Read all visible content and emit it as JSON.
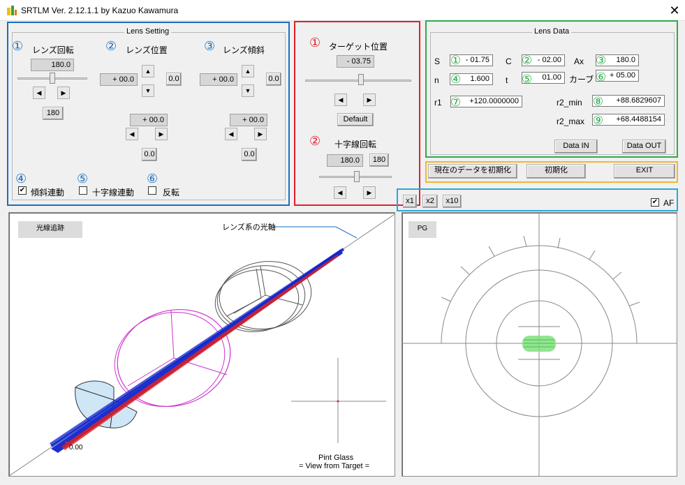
{
  "window": {
    "title": "SRTLM Ver. 2.12.1.1 by Kazuo Kawamura",
    "close_glyph": "✕"
  },
  "lens_setting": {
    "title": "Lens Setting",
    "rotation": {
      "num": "①",
      "label": "レンズ回転",
      "value": "180.0",
      "btn180": "180"
    },
    "position": {
      "num": "②",
      "label": "レンズ位置",
      "value1": "+ 00.0",
      "zero1": "0.0",
      "value2": "+ 00.0",
      "zero2": "0.0"
    },
    "tilt": {
      "num": "③",
      "label": "レンズ傾斜",
      "value1": "+ 00.0",
      "zero1": "0.0",
      "value2": "+ 00.0",
      "zero2": "0.0"
    },
    "tilt_link": {
      "num": "④",
      "label": "傾斜連動",
      "checked": "✔"
    },
    "cross_link": {
      "num": "⑤",
      "label": "十字線連動"
    },
    "reverse": {
      "num": "⑥",
      "label": "反転"
    }
  },
  "target": {
    "pos": {
      "num": "①",
      "label": "ターゲット位置",
      "value": "- 03.75",
      "default_btn": "Default"
    },
    "cross": {
      "num": "②",
      "label": "十字線回転",
      "value": "180.0",
      "btn180": "180"
    }
  },
  "lens_data": {
    "title": "Lens Data",
    "S": {
      "label": "S",
      "num": "①",
      "value": "- 01.75"
    },
    "C": {
      "label": "C",
      "num": "②",
      "value": "- 02.00"
    },
    "Ax": {
      "label": "Ax",
      "num": "③",
      "value": "180.0"
    },
    "n": {
      "label": "n",
      "num": "④",
      "value": "1.600"
    },
    "t": {
      "label": "t",
      "num": "⑤",
      "value": "01.00"
    },
    "curve": {
      "label": "カーブ",
      "num": "⑥",
      "value": "+ 05.00"
    },
    "r1": {
      "label": "r1",
      "num": "⑦",
      "value": "+120.0000000"
    },
    "r2min": {
      "label": "r2_min",
      "num": "⑧",
      "value": "+88.6829607"
    },
    "r2max": {
      "label": "r2_max",
      "num": "⑨",
      "value": "+68.4488154"
    },
    "data_in": "Data IN",
    "data_out": "Data OUT"
  },
  "actions": {
    "reset_current": "現在のデータを初期化",
    "reset": "初期化",
    "exit": "EXIT"
  },
  "zoom": {
    "x1": "x1",
    "x2": "x2",
    "x10": "x10",
    "af_label": "AF",
    "af_checked": "✔"
  },
  "ray_view": {
    "tag": "光線追跡",
    "axis_label": "レンズ系の光軸",
    "pint_glass": "Pint Glass",
    "view_from": "= View from Target =",
    "coord": "0.00"
  },
  "pg_view": {
    "tag": "PG"
  },
  "colors": {
    "blue": "#1a6fc0",
    "red": "#e0202a",
    "green": "#2eaa4a",
    "orange": "#f0b830",
    "cyan": "#2aa6d6"
  },
  "icons": {
    "arrow_left": "◀",
    "arrow_right": "▶",
    "arrow_up": "▲",
    "arrow_down": "▼"
  }
}
